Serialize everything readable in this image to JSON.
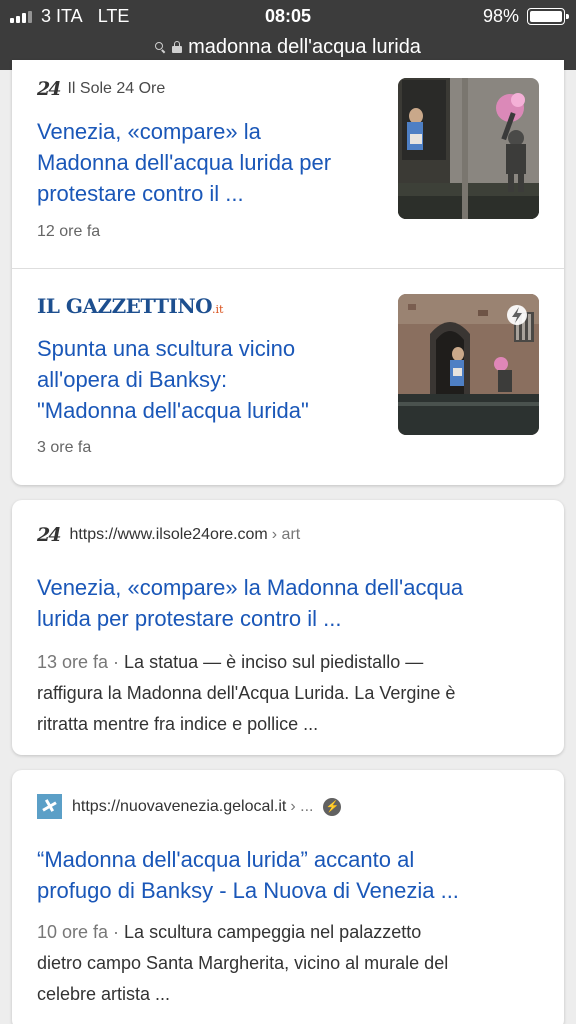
{
  "status": {
    "carrier": "3 ITA",
    "network": "LTE",
    "time": "08:05",
    "battery": "98%"
  },
  "address_bar": {
    "query": "madonna dell'acqua lurida",
    "icons": [
      "search-icon",
      "lock-icon"
    ]
  },
  "top_stories": [
    {
      "source_logo": "24",
      "source": "Il Sole 24 Ore",
      "title_lines": [
        "Venezia, «compare» la",
        "Madonna dell'acqua lurida per",
        "protestare contro il ..."
      ],
      "age": "12 ore fa",
      "has_amp": false
    },
    {
      "source_logo": "IL GAZZETTINO",
      "source_logo_suffix": ".it",
      "title_lines": [
        "Spunta una scultura vicino",
        "all'opera di Banksy:",
        "\"Madonna dell'acqua lurida\""
      ],
      "age": "3 ore fa",
      "has_amp": true
    }
  ],
  "results": [
    {
      "favicon": "24",
      "url": "https://www.ilsole24ore.com",
      "breadcrumb": "› art",
      "title_lines": [
        "Venezia, «compare» la Madonna dell'acqua",
        "lurida per protestare contro il ..."
      ],
      "date": "13 ore fa ·",
      "snippet_lines": [
        " La statua — è inciso sul piedistallo —",
        "raffigura la Madonna dell'Acqua Lurida. La Vergine è",
        "ritratta mentre fra indice e pollice ..."
      ]
    },
    {
      "favicon": "nuovavenezia-icon",
      "url": "https://nuovavenezia.gelocal.it",
      "breadcrumb": "› ...",
      "amp_icon": "amp-lightning-icon",
      "title_lines": [
        "“Madonna dell'acqua lurida” accanto al",
        "profugo di Banksy - La Nuova di Venezia ..."
      ],
      "date": "10 ore fa ·",
      "snippet_lines": [
        " La scultura campeggia nel palazzetto",
        "dietro campo Santa Margherita, vicino al murale del",
        "celebre artista ..."
      ]
    }
  ],
  "colors": {
    "link": "#1a57b8",
    "topbar": "#3c3c3c",
    "background": "#ededed"
  }
}
